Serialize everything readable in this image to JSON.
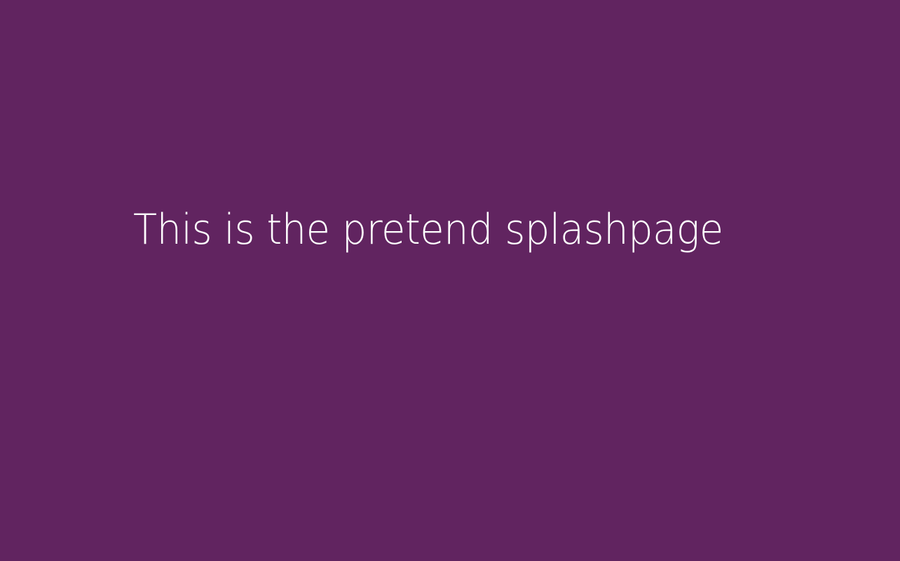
{
  "splash": {
    "message": "This is the pretend splashpage"
  },
  "colors": {
    "background": "#612460",
    "text": "#ffffff"
  }
}
